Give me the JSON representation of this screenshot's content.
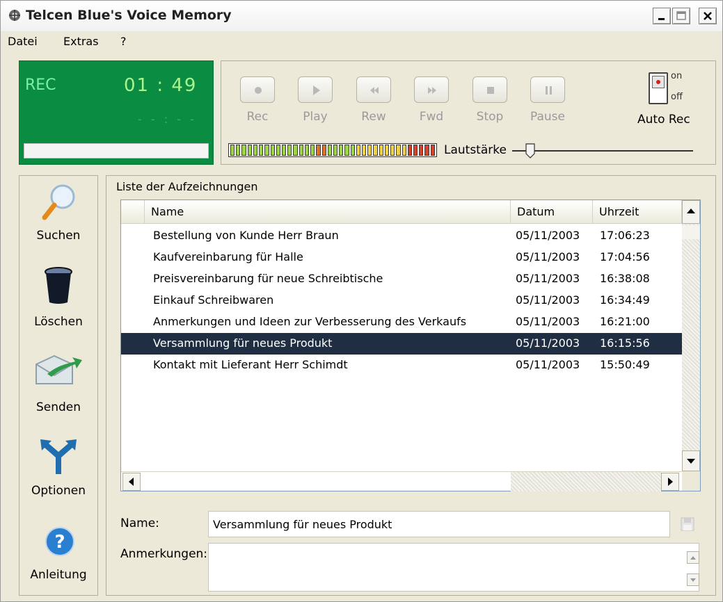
{
  "window": {
    "title": "Telcen Blue's Voice Memory",
    "controls": [
      "minimize-icon",
      "maximize-icon",
      "close-icon"
    ]
  },
  "menu": {
    "items": [
      {
        "label": "Datei"
      },
      {
        "label": "Extras"
      },
      {
        "label": "?"
      }
    ]
  },
  "recorder": {
    "status": "REC",
    "time": "01 : 49",
    "sub_time": "- - : - -"
  },
  "transport": {
    "buttons": [
      {
        "label": "Rec",
        "icon": "record-icon"
      },
      {
        "label": "Play",
        "icon": "play-icon"
      },
      {
        "label": "Rew",
        "icon": "rewind-icon"
      },
      {
        "label": "Fwd",
        "icon": "fast-forward-icon"
      },
      {
        "label": "Stop",
        "icon": "stop-icon"
      },
      {
        "label": "Pause",
        "icon": "pause-icon"
      }
    ],
    "autorec": {
      "label": "Auto Rec",
      "on_label": "on",
      "off_label": "off"
    },
    "volume_label": "Lautstärke",
    "vu_level": 0.42,
    "volume_level": 0.1
  },
  "sidebar": {
    "items": [
      {
        "label": "Suchen",
        "icon": "search-icon"
      },
      {
        "label": "Löschen",
        "icon": "trash-icon"
      },
      {
        "label": "Senden",
        "icon": "send-icon"
      },
      {
        "label": "Optionen",
        "icon": "options-icon"
      },
      {
        "label": "Anleitung",
        "icon": "help-icon"
      }
    ]
  },
  "recordings": {
    "title": "Liste der Aufzeichnungen",
    "columns": [
      "Name",
      "Datum",
      "Uhrzeit"
    ],
    "rows": [
      {
        "name": "Bestellung von Kunde Herr Braun",
        "date": "05/11/2003",
        "time": "17:06:23"
      },
      {
        "name": "Kaufvereinbarung für Halle",
        "date": "05/11/2003",
        "time": "17:04:56"
      },
      {
        "name": "Preisvereinbarung für neue Schreibtische",
        "date": "05/11/2003",
        "time": "16:38:08"
      },
      {
        "name": "Einkauf Schreibwaren",
        "date": "05/11/2003",
        "time": "16:34:49"
      },
      {
        "name": "Anmerkungen und Ideen zur Verbesserung des Verkaufs",
        "date": "05/11/2003",
        "time": "16:21:00"
      },
      {
        "name": "Versammlung für neues Produkt",
        "date": "05/11/2003",
        "time": "16:15:56",
        "selected": true
      },
      {
        "name": "Kontakt mit Lieferant Herr Schimdt",
        "date": "05/11/2003",
        "time": "15:50:49"
      }
    ]
  },
  "details": {
    "name_label": "Name:",
    "name_value": "Versammlung für neues Produkt",
    "notes_label": "Anmerkungen:",
    "notes_value": ""
  },
  "colors": {
    "selection": "#1f2e42",
    "display_green": "#0a8c43"
  }
}
